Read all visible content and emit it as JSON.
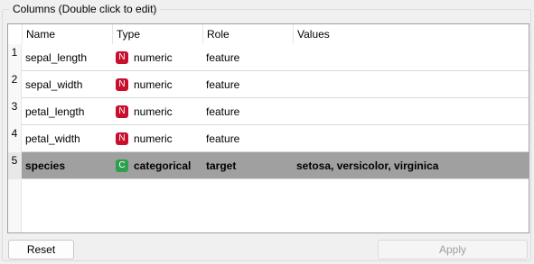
{
  "group": {
    "title": "Columns (Double click to edit)"
  },
  "table": {
    "headers": [
      "Name",
      "Type",
      "Role",
      "Values"
    ],
    "rows": [
      {
        "index": "1",
        "name": "sepal_length",
        "type_badge": "N",
        "type": "numeric",
        "role": "feature",
        "values": ""
      },
      {
        "index": "2",
        "name": "sepal_width",
        "type_badge": "N",
        "type": "numeric",
        "role": "feature",
        "values": ""
      },
      {
        "index": "3",
        "name": "petal_length",
        "type_badge": "N",
        "type": "numeric",
        "role": "feature",
        "values": ""
      },
      {
        "index": "4",
        "name": "petal_width",
        "type_badge": "N",
        "type": "numeric",
        "role": "feature",
        "values": ""
      },
      {
        "index": "5",
        "name": "species",
        "type_badge": "C",
        "type": "categorical",
        "role": "target",
        "values": "setosa, versicolor, virginica"
      }
    ],
    "selected_row": "5"
  },
  "buttons": {
    "reset_label": "Reset",
    "apply_label": "Apply"
  },
  "colors": {
    "numeric_badge": "#c8102e",
    "categorical_badge": "#2e9e4f",
    "selected_row": "#a0a0a0"
  },
  "icons": {
    "numeric": "numeric-type-icon",
    "categorical": "categorical-type-icon"
  }
}
